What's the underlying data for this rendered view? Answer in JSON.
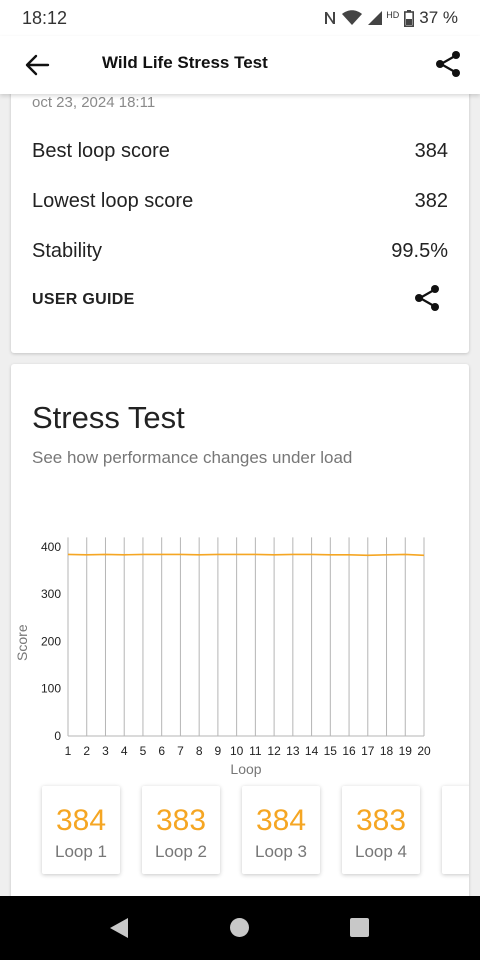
{
  "status_bar": {
    "time": "18:12",
    "battery": "37 %",
    "network_label": "HD"
  },
  "app_bar": {
    "title": "Wild Life Stress Test",
    "back_icon": "arrow-left-icon",
    "share_icon": "share-icon"
  },
  "summary": {
    "date": "oct 23, 2024 18:11",
    "rows": [
      {
        "label": "Best loop score",
        "value": "384"
      },
      {
        "label": "Lowest loop score",
        "value": "382"
      },
      {
        "label": "Stability",
        "value": "99.5%"
      }
    ],
    "guide_label": "USER GUIDE"
  },
  "stress": {
    "title": "Stress Test",
    "subtitle": "See how performance changes under load"
  },
  "chart_data": {
    "type": "line",
    "x": [
      1,
      2,
      3,
      4,
      5,
      6,
      7,
      8,
      9,
      10,
      11,
      12,
      13,
      14,
      15,
      16,
      17,
      18,
      19,
      20
    ],
    "series": [
      {
        "values": [
          384,
          383,
          384,
          383,
          384,
          384,
          384,
          383,
          384,
          384,
          384,
          383,
          384,
          384,
          383,
          383,
          382,
          383,
          384,
          382
        ]
      }
    ],
    "xlabel": "Loop",
    "ylabel": "Score",
    "ylim": [
      0,
      420
    ],
    "yticks": [
      0,
      100,
      200,
      300,
      400
    ],
    "grid": "vertical",
    "color": "#f5a623"
  },
  "loops": [
    {
      "score": "384",
      "label": "Loop 1"
    },
    {
      "score": "383",
      "label": "Loop 2"
    },
    {
      "score": "384",
      "label": "Loop 3"
    },
    {
      "score": "383",
      "label": "Loop 4"
    }
  ]
}
